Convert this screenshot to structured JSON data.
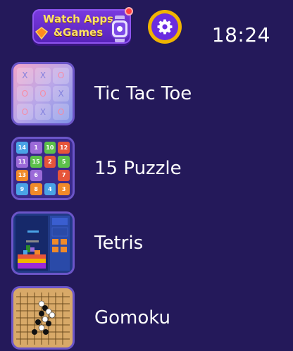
{
  "header": {
    "logo_line1": "Watch Apps",
    "logo_line2": "&Games",
    "settings_icon": "gear-icon",
    "time": "18:24"
  },
  "colors": {
    "background": "#24195a",
    "accent_gold": "#f0b400",
    "accent_purple": "#6a2ce0",
    "thumb_border": "#6b55c8"
  },
  "games": [
    {
      "label": "Tic Tac Toe",
      "icon": "tic-tac-toe-thumbnail"
    },
    {
      "label": "15 Puzzle",
      "icon": "15-puzzle-thumbnail"
    },
    {
      "label": "Tetris",
      "icon": "tetris-thumbnail"
    },
    {
      "label": "Gomoku",
      "icon": "gomoku-thumbnail"
    }
  ],
  "puzzle_tiles": [
    "14",
    "1",
    "10",
    "12",
    "11",
    "15",
    "2",
    "5",
    "13",
    "6",
    "",
    "7",
    "9",
    "8",
    "4",
    "3"
  ],
  "ttt_marks": [
    "X",
    "X",
    "O",
    "O",
    "O",
    "X",
    "O",
    "X",
    "O"
  ]
}
